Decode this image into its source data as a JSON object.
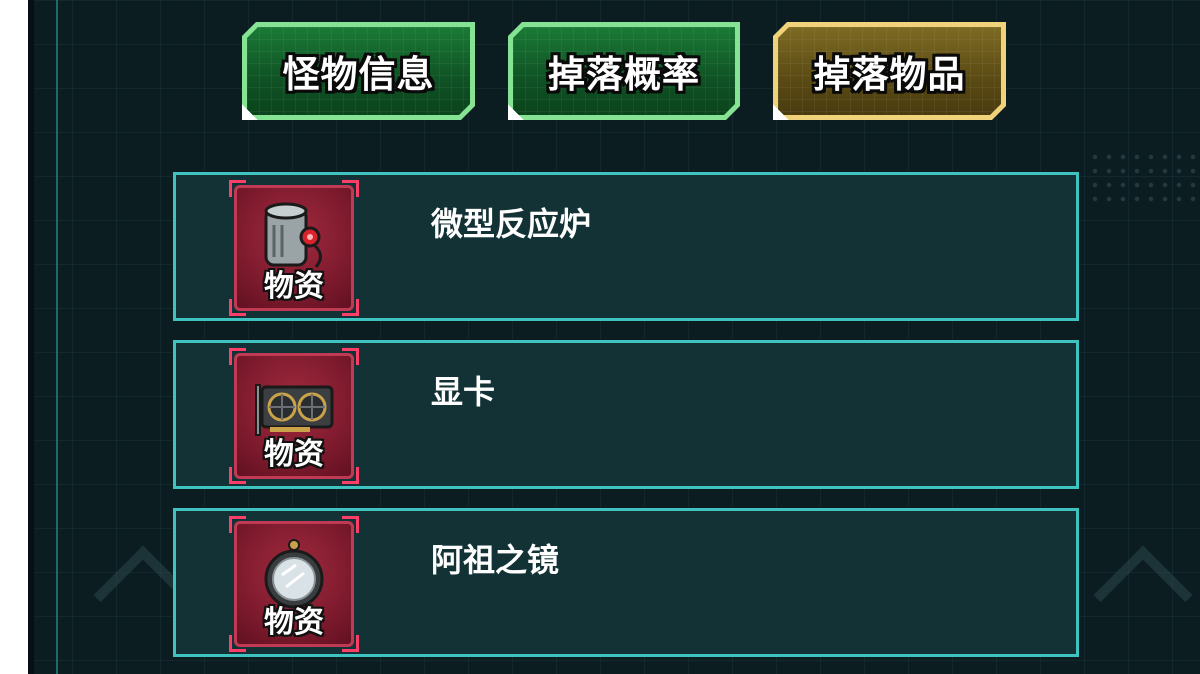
{
  "tabs": [
    {
      "label": "怪物信息",
      "state": "green"
    },
    {
      "label": "掉落概率",
      "state": "green"
    },
    {
      "label": "掉落物品",
      "state": "gold",
      "selected": true
    }
  ],
  "items": [
    {
      "name": "微型反应炉",
      "tag": "物资",
      "icon": "reactor-icon"
    },
    {
      "name": "显卡",
      "tag": "物资",
      "icon": "graphics-card-icon"
    },
    {
      "name": "阿祖之镜",
      "tag": "物资",
      "icon": "mirror-icon"
    }
  ],
  "colors": {
    "panel_bg": "#0c1d22",
    "row_bg": "#133235",
    "row_border": "#3fc3c0",
    "tab_green": "#86e394",
    "tab_gold": "#f0d27a",
    "icon_bg": "#7d1a2d",
    "icon_bracket": "#ff3d6a"
  }
}
